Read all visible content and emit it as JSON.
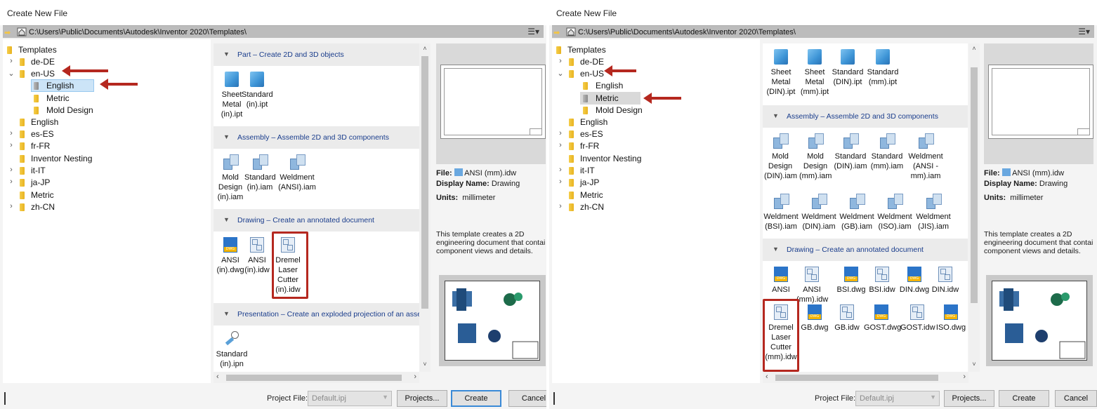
{
  "left": {
    "title": "Create New File",
    "path": "C:\\Users\\Public\\Documents\\Autodesk\\Inventor 2020\\Templates\\",
    "tree": [
      {
        "label": "Templates",
        "chev": ""
      },
      {
        "label": "de-DE",
        "chev": ">"
      },
      {
        "label": "en-US",
        "chev": "v"
      },
      {
        "label": "English",
        "chev": ""
      },
      {
        "label": "Metric",
        "chev": ""
      },
      {
        "label": "Mold Design",
        "chev": ""
      },
      {
        "label": "English",
        "chev": ""
      },
      {
        "label": "es-ES",
        "chev": ">"
      },
      {
        "label": "fr-FR",
        "chev": ">"
      },
      {
        "label": "Inventor Nesting",
        "chev": ""
      },
      {
        "label": "it-IT",
        "chev": ">"
      },
      {
        "label": "ja-JP",
        "chev": ">"
      },
      {
        "label": "Metric",
        "chev": ""
      },
      {
        "label": "zh-CN",
        "chev": ">"
      }
    ],
    "categories": {
      "part": "Part – Create 2D and 3D objects",
      "assembly": "Assembly – Assemble 2D and 3D components",
      "drawing": "Drawing – Create an annotated document",
      "presentation": "Presentation – Create an exploded projection of an asser"
    },
    "tiles": {
      "part": [
        "Sheet Metal (in).ipt",
        "Standard (in).ipt"
      ],
      "assembly": [
        "Mold Design (in).iam",
        "Standard (in).iam",
        "Weldment (ANSI).iam"
      ],
      "drawing": [
        "ANSI (in).dwg",
        "ANSI (in).idw",
        "Dremel Laser Cutter (in).idw"
      ],
      "presentation": [
        "Standard (in).ipn"
      ]
    },
    "info": {
      "file_label": "File:",
      "file_value": "ANSI (mm).idw",
      "display_label": "Display Name:",
      "display_value": "Drawing",
      "units_label": "Units:",
      "units_value": "millimeter",
      "description": [
        "This template creates a 2D",
        "engineering document that contai",
        "component views and details."
      ]
    },
    "footer": {
      "project_label": "Project File:",
      "project_value": "Default.ipj",
      "projects_btn": "Projects...",
      "create_btn": "Create",
      "cancel_btn": "Cancel"
    }
  },
  "right": {
    "title": "Create New File",
    "path": "C:\\Users\\Public\\Documents\\Autodesk\\Inventor 2020\\Templates\\",
    "tree": [
      {
        "label": "Templates",
        "chev": ""
      },
      {
        "label": "de-DE",
        "chev": ">"
      },
      {
        "label": "en-US",
        "chev": "v"
      },
      {
        "label": "English",
        "chev": ""
      },
      {
        "label": "Metric",
        "chev": ""
      },
      {
        "label": "Mold Design",
        "chev": ""
      },
      {
        "label": "English",
        "chev": ""
      },
      {
        "label": "es-ES",
        "chev": ">"
      },
      {
        "label": "fr-FR",
        "chev": ">"
      },
      {
        "label": "Inventor Nesting",
        "chev": ""
      },
      {
        "label": "it-IT",
        "chev": ">"
      },
      {
        "label": "ja-JP",
        "chev": ">"
      },
      {
        "label": "Metric",
        "chev": ""
      },
      {
        "label": "zh-CN",
        "chev": ">"
      }
    ],
    "categories": {
      "assembly": "Assembly – Assemble 2D and 3D components",
      "drawing": "Drawing – Create an annotated document"
    },
    "tiles": {
      "part": [
        "Sheet Metal (DIN).ipt",
        "Sheet Metal (mm).ipt",
        "Standard (DIN).ipt",
        "Standard (mm).ipt"
      ],
      "assembly1": [
        "Mold Design (DIN).iam",
        "Mold Design (mm).iam",
        "Standard (DIN).iam",
        "Standard (mm).iam",
        "Weldment (ANSI - mm).iam"
      ],
      "assembly2": [
        "Weldment (BSI).iam",
        "Weldment (DIN).iam",
        "Weldment (GB).iam",
        "Weldment (ISO).iam",
        "Weldment (JIS).iam"
      ],
      "drawing1": [
        "ANSI",
        "ANSI (mm).idw",
        "BSI.dwg",
        "BSI.idw",
        "DIN.dwg",
        "DIN.idw"
      ],
      "drawing2": [
        "Dremel Laser Cutter (mm).idw",
        "GB.dwg",
        "GB.idw",
        "GOST.dwg",
        "GOST.idw",
        "ISO.dwg"
      ]
    },
    "info": {
      "file_label": "File:",
      "file_value": "ANSI (mm).idw",
      "display_label": "Display Name:",
      "display_value": "Drawing",
      "units_label": "Units:",
      "units_value": "millimeter",
      "description": [
        "This template creates a 2D",
        "engineering document that contai",
        "component views and details."
      ]
    },
    "footer": {
      "project_label": "Project File:",
      "project_value": "Default.ipj",
      "projects_btn": "Projects...",
      "create_btn": "Create",
      "cancel_btn": "Cancel"
    }
  },
  "colors": {
    "annotation": "#b5281f",
    "selection": "#cce4f7",
    "link_text": "#1a3d8c"
  }
}
